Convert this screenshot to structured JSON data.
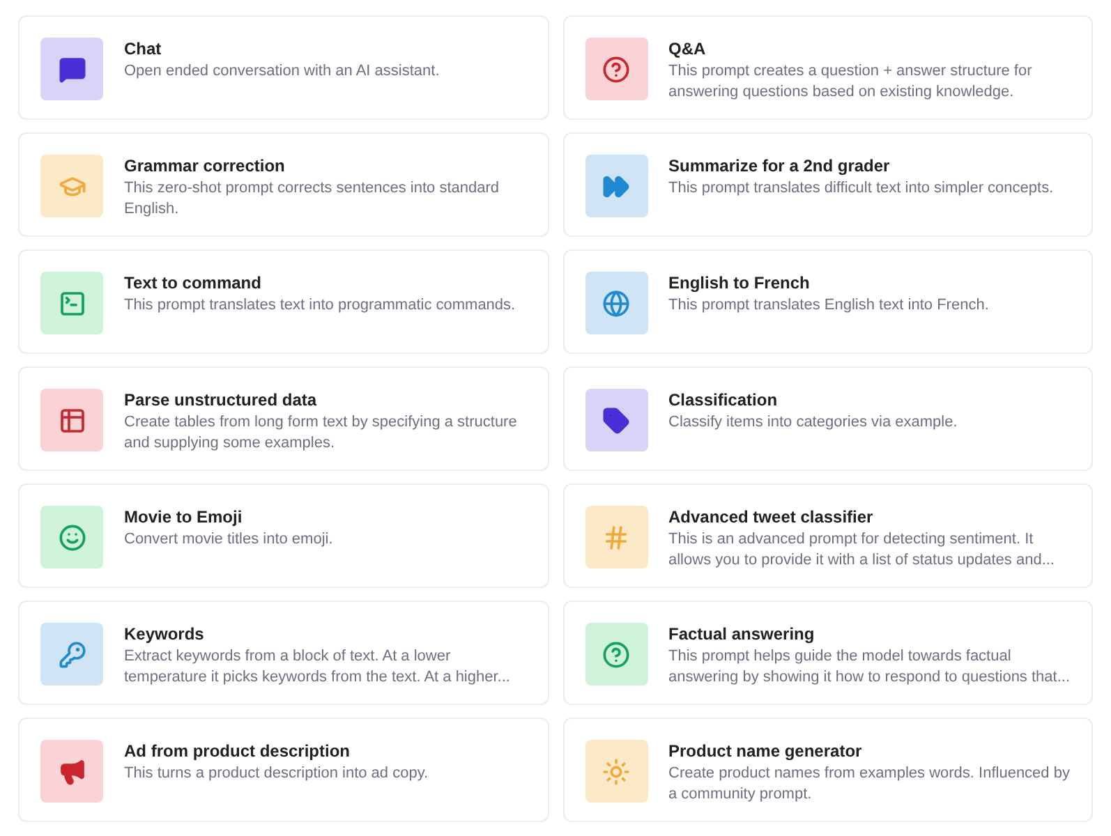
{
  "examples": [
    {
      "kind": "chat",
      "color": "#d9d4f7",
      "title": "Chat",
      "description": "Open ended conversation with an AI assistant."
    },
    {
      "kind": "question",
      "color": "#f9d3d5",
      "title": "Q&A",
      "description": "This prompt creates a question + answer structure for answering questions based on existing knowledge."
    },
    {
      "kind": "graduation",
      "color": "#fce9c8",
      "title": "Grammar correction",
      "description": "This zero-shot prompt corrects sentences into standard English."
    },
    {
      "kind": "forward",
      "color": "#cfe4f4",
      "title": "Summarize for a 2nd grader",
      "description": "This prompt translates difficult text into simpler concepts."
    },
    {
      "kind": "terminal",
      "color": "#cff3d9",
      "title": "Text to command",
      "description": "This prompt translates text into programmatic commands."
    },
    {
      "kind": "globe",
      "color": "#cfe4f4",
      "title": "English to French",
      "description": "This prompt translates English text into French."
    },
    {
      "kind": "table",
      "color": "#f9d3d5",
      "title": "Parse unstructured data",
      "description": "Create tables from long form text by specifying a structure and supplying some examples."
    },
    {
      "kind": "tag",
      "color": "#d9d4f7",
      "title": "Classification",
      "description": "Classify items into categories via example."
    },
    {
      "kind": "smile",
      "color": "#cff3d9",
      "title": "Movie to Emoji",
      "description": "Convert movie titles into emoji."
    },
    {
      "kind": "hash",
      "color": "#fce9c8",
      "title": "Advanced tweet classifier",
      "description": "This is an advanced prompt for detecting sentiment. It allows you to provide it with a list of status updates and..."
    },
    {
      "kind": "key",
      "color": "#cfe4f4",
      "title": "Keywords",
      "description": "Extract keywords from a block of text. At a lower temperature it picks keywords from the text. At a higher..."
    },
    {
      "kind": "help",
      "color": "#cff3d9",
      "title": "Factual answering",
      "description": "This prompt helps guide the model towards factual answering by showing it how to respond to questions that..."
    },
    {
      "kind": "megaphone",
      "color": "#f9d3d5",
      "title": "Ad from product description",
      "description": "This turns a product description into ad copy."
    },
    {
      "kind": "bulb",
      "color": "#fce9c8",
      "title": "Product name generator",
      "description": "Create product names from examples words. Influenced by a community prompt."
    }
  ]
}
